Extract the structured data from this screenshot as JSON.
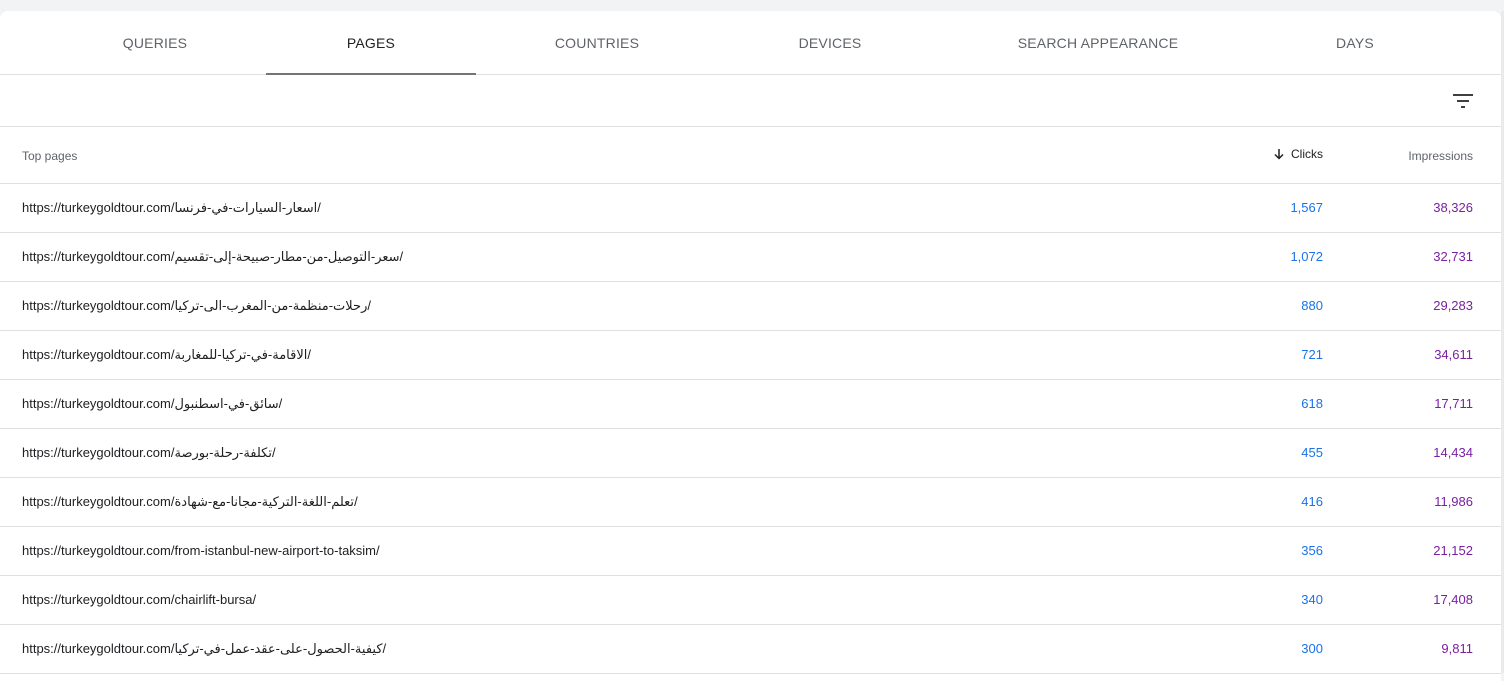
{
  "tabs": [
    {
      "label": "QUERIES"
    },
    {
      "label": "PAGES"
    },
    {
      "label": "COUNTRIES"
    },
    {
      "label": "DEVICES"
    },
    {
      "label": "SEARCH APPEARANCE"
    },
    {
      "label": "DAYS"
    }
  ],
  "active_tab": "PAGES",
  "table": {
    "columns": {
      "pages": "Top pages",
      "clicks": "Clicks",
      "impressions": "Impressions",
      "sort": "clicks-desc"
    },
    "rows": [
      {
        "url": "https://turkeygoldtour.com/اسعار-السيارات-في-فرنسا/",
        "clicks": "1,567",
        "impressions": "38,326"
      },
      {
        "url": "https://turkeygoldtour.com/سعر-التوصيل-من-مطار-صبيحة-إلى-تقسيم/",
        "clicks": "1,072",
        "impressions": "32,731"
      },
      {
        "url": "https://turkeygoldtour.com/رحلات-منظمة-من-المغرب-الى-تركيا/",
        "clicks": "880",
        "impressions": "29,283"
      },
      {
        "url": "https://turkeygoldtour.com/الاقامة-في-تركيا-للمغاربة/",
        "clicks": "721",
        "impressions": "34,611"
      },
      {
        "url": "https://turkeygoldtour.com/سائق-في-اسطنبول/",
        "clicks": "618",
        "impressions": "17,711"
      },
      {
        "url": "https://turkeygoldtour.com/تكلفة-رحلة-بورصة/",
        "clicks": "455",
        "impressions": "14,434"
      },
      {
        "url": "https://turkeygoldtour.com/تعلم-اللغة-التركية-مجانا-مع-شهادة/",
        "clicks": "416",
        "impressions": "11,986"
      },
      {
        "url": "https://turkeygoldtour.com/from-istanbul-new-airport-to-taksim/",
        "clicks": "356",
        "impressions": "21,152"
      },
      {
        "url": "https://turkeygoldtour.com/chairlift-bursa/",
        "clicks": "340",
        "impressions": "17,408"
      },
      {
        "url": "https://turkeygoldtour.com/كيفية-الحصول-على-عقد-عمل-في-تركيا/",
        "clicks": "300",
        "impressions": "9,811"
      }
    ]
  },
  "icons": {
    "filter": "filter-icon",
    "sort": "arrow-down-icon"
  },
  "colors": {
    "clicks": "#1a73e8",
    "impressions": "#7b1fa2"
  }
}
